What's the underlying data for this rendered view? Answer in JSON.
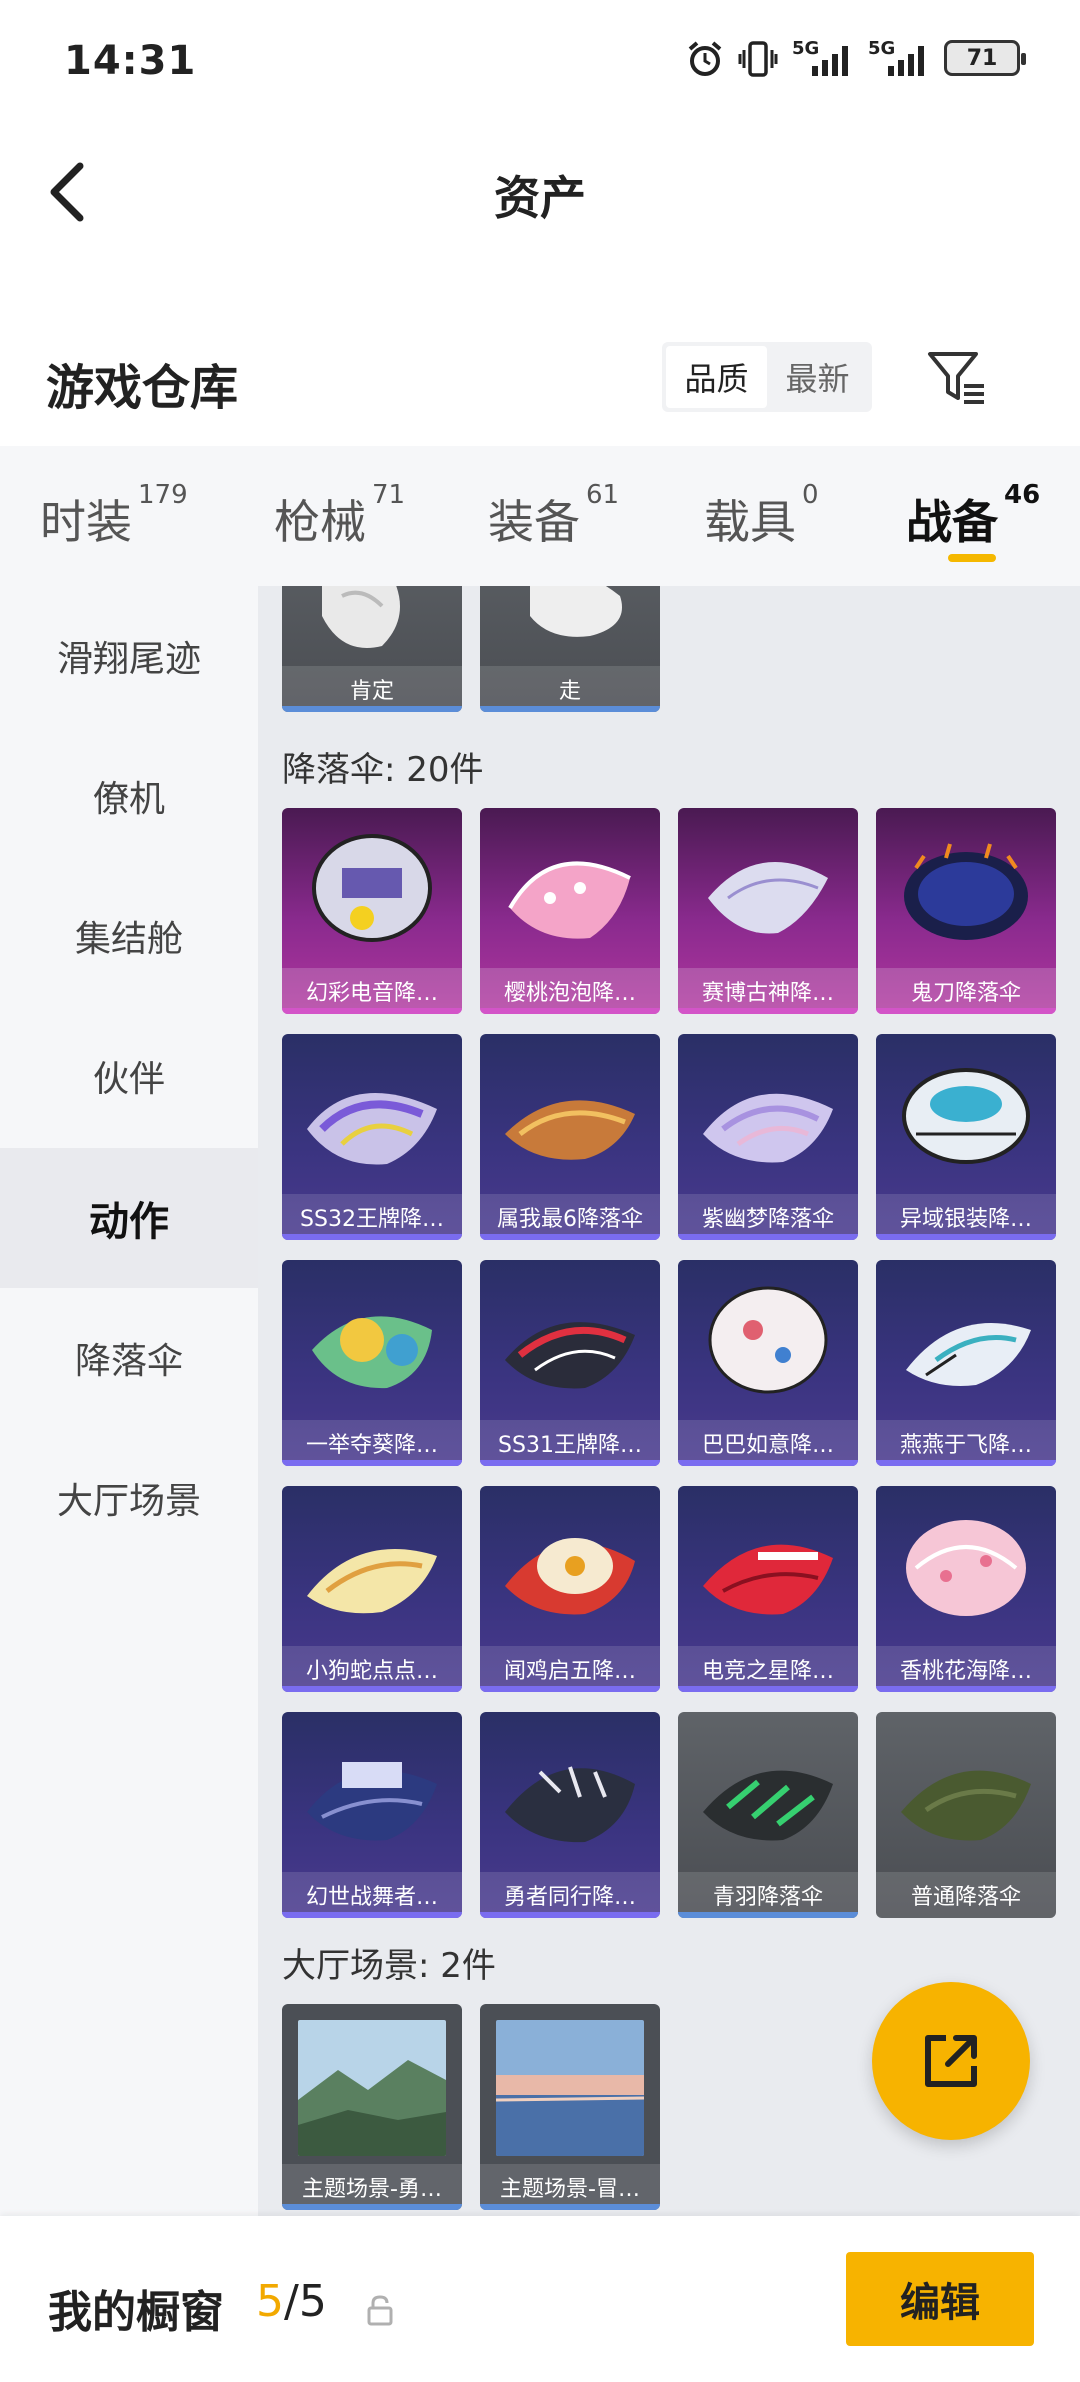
{
  "status_bar": {
    "time": "14:31",
    "net1": "5G",
    "net2": "5G",
    "battery": "71",
    "icons": [
      "alarm-icon",
      "vibrate-icon",
      "signal-5g-icon",
      "signal-5g-icon",
      "battery-icon"
    ]
  },
  "header": {
    "title": "资产",
    "back_icon": "chevron-left-icon"
  },
  "warehouse": {
    "title": "游戏仓库",
    "sort_options": [
      "品质",
      "最新"
    ],
    "sort_selected": "品质",
    "filter_icon": "filter-icon"
  },
  "tabs": [
    {
      "label": "时装",
      "count": "179"
    },
    {
      "label": "枪械",
      "count": "71"
    },
    {
      "label": "装备",
      "count": "61"
    },
    {
      "label": "载具",
      "count": "0"
    },
    {
      "label": "战备",
      "count": "46"
    }
  ],
  "active_tab": "战备",
  "sidebar": {
    "items": [
      "滑翔尾迹",
      "僚机",
      "集结舱",
      "伙伴",
      "动作",
      "降落伞",
      "大厅场景"
    ],
    "active": "动作"
  },
  "actions_items": [
    {
      "name": "肯定"
    },
    {
      "name": "走"
    }
  ],
  "parachute_section": {
    "title": "降落伞: 20件",
    "items": [
      {
        "name": "幻彩电音降…",
        "rarity": "pink"
      },
      {
        "name": "樱桃泡泡降…",
        "rarity": "pink"
      },
      {
        "name": "赛博古神降…",
        "rarity": "pink"
      },
      {
        "name": "鬼刀降落伞",
        "rarity": "pink"
      },
      {
        "name": "SS32王牌降…",
        "rarity": "purple"
      },
      {
        "name": "属我最6降落伞",
        "rarity": "purple"
      },
      {
        "name": "紫幽梦降落伞",
        "rarity": "purple"
      },
      {
        "name": "异域银装降…",
        "rarity": "purple"
      },
      {
        "name": "一举夺葵降…",
        "rarity": "purple"
      },
      {
        "name": "SS31王牌降…",
        "rarity": "purple"
      },
      {
        "name": "巴巴如意降…",
        "rarity": "purple"
      },
      {
        "name": "燕燕于飞降…",
        "rarity": "purple"
      },
      {
        "name": "小狗蛇点点…",
        "rarity": "purple"
      },
      {
        "name": "闻鸡启五降…",
        "rarity": "purple"
      },
      {
        "name": "电竞之星降…",
        "rarity": "purple"
      },
      {
        "name": "香桃花海降…",
        "rarity": "purple"
      },
      {
        "name": "幻世战舞者…",
        "rarity": "purple"
      },
      {
        "name": "勇者同行降…",
        "rarity": "purple"
      },
      {
        "name": "青羽降落伞",
        "rarity": "gray"
      },
      {
        "name": "普通降落伞",
        "rarity": "gray"
      }
    ]
  },
  "lobby_section": {
    "title": "大厅场景: 2件",
    "items": [
      {
        "name": "主题场景-勇…"
      },
      {
        "name": "主题场景-冒…"
      }
    ]
  },
  "fab": {
    "icon": "share-external-icon"
  },
  "bottom_bar": {
    "label": "我的橱窗",
    "count_current": "5",
    "count_sep": "/",
    "count_total": "5",
    "lock_icon": "lock-icon",
    "edit_label": "编辑"
  },
  "colors": {
    "accent": "#f7b300",
    "pink_rarity": "#b0369e",
    "purple_rarity": "#3a3480",
    "gray_rarity": "#5f6368"
  }
}
